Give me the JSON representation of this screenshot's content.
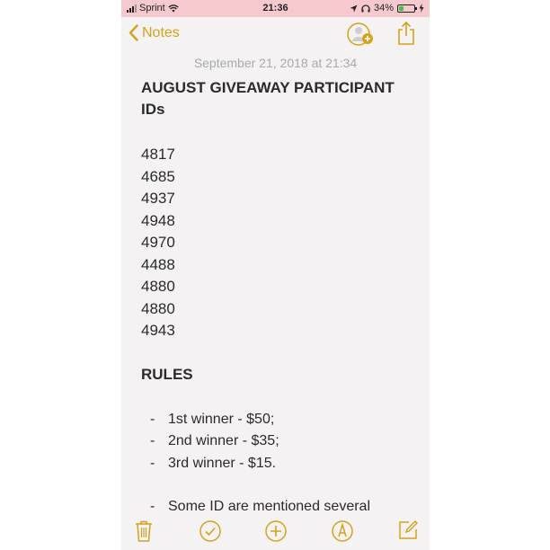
{
  "status_bar": {
    "carrier": "Sprint",
    "time": "21:36",
    "battery": "34%",
    "battery_level": 0.34,
    "battery_color": "#3ec34b"
  },
  "nav": {
    "back_label": "Notes",
    "accent": "#d5a21b",
    "icons": [
      "chevron-left-icon",
      "add-people-icon",
      "share-icon"
    ]
  },
  "note": {
    "date": "September 21, 2018 at 21:34",
    "title_line1": "AUGUST GIVEAWAY PARTICIPANT",
    "title_line2": "IDs",
    "ids": [
      "4817",
      "4685",
      "4937",
      "4948",
      "4970",
      "4488",
      "4880",
      "4880",
      "4943"
    ],
    "rules_heading": "RULES",
    "rules": [
      {
        "dash": "-",
        "text": "1st winner - $50;"
      },
      {
        "dash": "-",
        "text": "2nd winner - $35;"
      },
      {
        "dash": "-",
        "text": "3rd winner - $15."
      },
      {
        "dash": "-",
        "text": "Some ID are mentioned several"
      }
    ]
  },
  "toolbar": {
    "icons": [
      "trash-icon",
      "checklist-icon",
      "add-icon",
      "markup-icon",
      "compose-icon"
    ]
  }
}
